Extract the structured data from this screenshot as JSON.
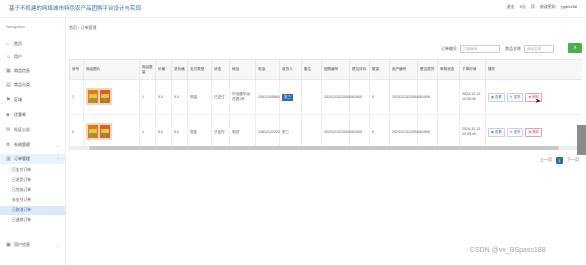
{
  "header": {
    "title": "基于不机建的网络城市特色农产品团购平台设计与实现",
    "links": [
      "退出",
      "5分",
      "顶",
      "修改密码",
      "ygdfs188"
    ]
  },
  "sidebar": {
    "heading": "Navigation",
    "items": [
      {
        "label": "首页",
        "icon": "home-icon"
      },
      {
        "label": "用户",
        "icon": "user-icon"
      },
      {
        "label": "商品信息",
        "icon": "goods-icon"
      },
      {
        "label": "商品分类",
        "icon": "category-icon"
      },
      {
        "label": "区域",
        "icon": "region-icon"
      },
      {
        "label": "优惠券",
        "icon": "coupon-icon"
      },
      {
        "label": "社区公告",
        "icon": "notice-icon"
      },
      {
        "label": "系统管理",
        "icon": "gear-icon"
      },
      {
        "label": "订单管理",
        "icon": "order-icon"
      }
    ],
    "sub_items": [
      "已支付订单",
      "已发货订单",
      "已完成订单",
      "未支付订单",
      "已取消订单",
      "已退款订单"
    ],
    "last_item": {
      "label": "用户信息",
      "icon": "info-icon"
    }
  },
  "breadcrumb": {
    "home": "首页",
    "sep": "/",
    "current": "订单管理"
  },
  "filters": {
    "order_label": "订单编号",
    "order_placeholder": "订单编号",
    "name_label": "商品名称",
    "name_placeholder": "商品名称"
  },
  "table": {
    "headers": [
      "序号",
      "商品图片",
      "商品数量",
      "价格",
      "总价格",
      "支付类型",
      "状态",
      "地址",
      "电话",
      "收货人",
      "备注",
      "团购编号",
      "是否评价",
      "数量",
      "用户编号",
      "是否退货",
      "审核状态",
      "下单时间",
      "操作"
    ],
    "rows": [
      {
        "no": "1",
        "qty": "1",
        "price": "9.0",
        "total": "9.0",
        "pay": "现金",
        "status": "已支付",
        "address": "华远路华远花园1号",
        "phone": "13612345681",
        "receiver": "张三",
        "note": "",
        "group_no": "2024121312054061905",
        "rated": "",
        "count": "0",
        "user_no": "2024121312054061906",
        "returned": "",
        "review": "",
        "time": "2024-12-13 12:05:40",
        "actions": [
          "查看",
          "发货",
          "删除"
        ]
      },
      {
        "no": "2",
        "qty": "1",
        "price": "9.0",
        "total": "9.0",
        "pay": "现金",
        "status": "已支付",
        "address": "测试",
        "phone": "13612122222",
        "receiver": "张三",
        "note": "",
        "group_no": "2024121312054061905",
        "rated": "",
        "count": "0",
        "user_no": "2024121312054061906",
        "returned": "",
        "review": "",
        "time": "2024-12-13 12:05:40",
        "actions": [
          "查看",
          "发货",
          "删除"
        ]
      }
    ]
  },
  "pager": {
    "prev": "上一页",
    "current": "1",
    "next": "下一页"
  },
  "watermark": "CSDN @vx_BSpass188",
  "colors": {
    "accent": "#2d6db5",
    "search": "#4cae4c",
    "delete": "#d9534f"
  }
}
